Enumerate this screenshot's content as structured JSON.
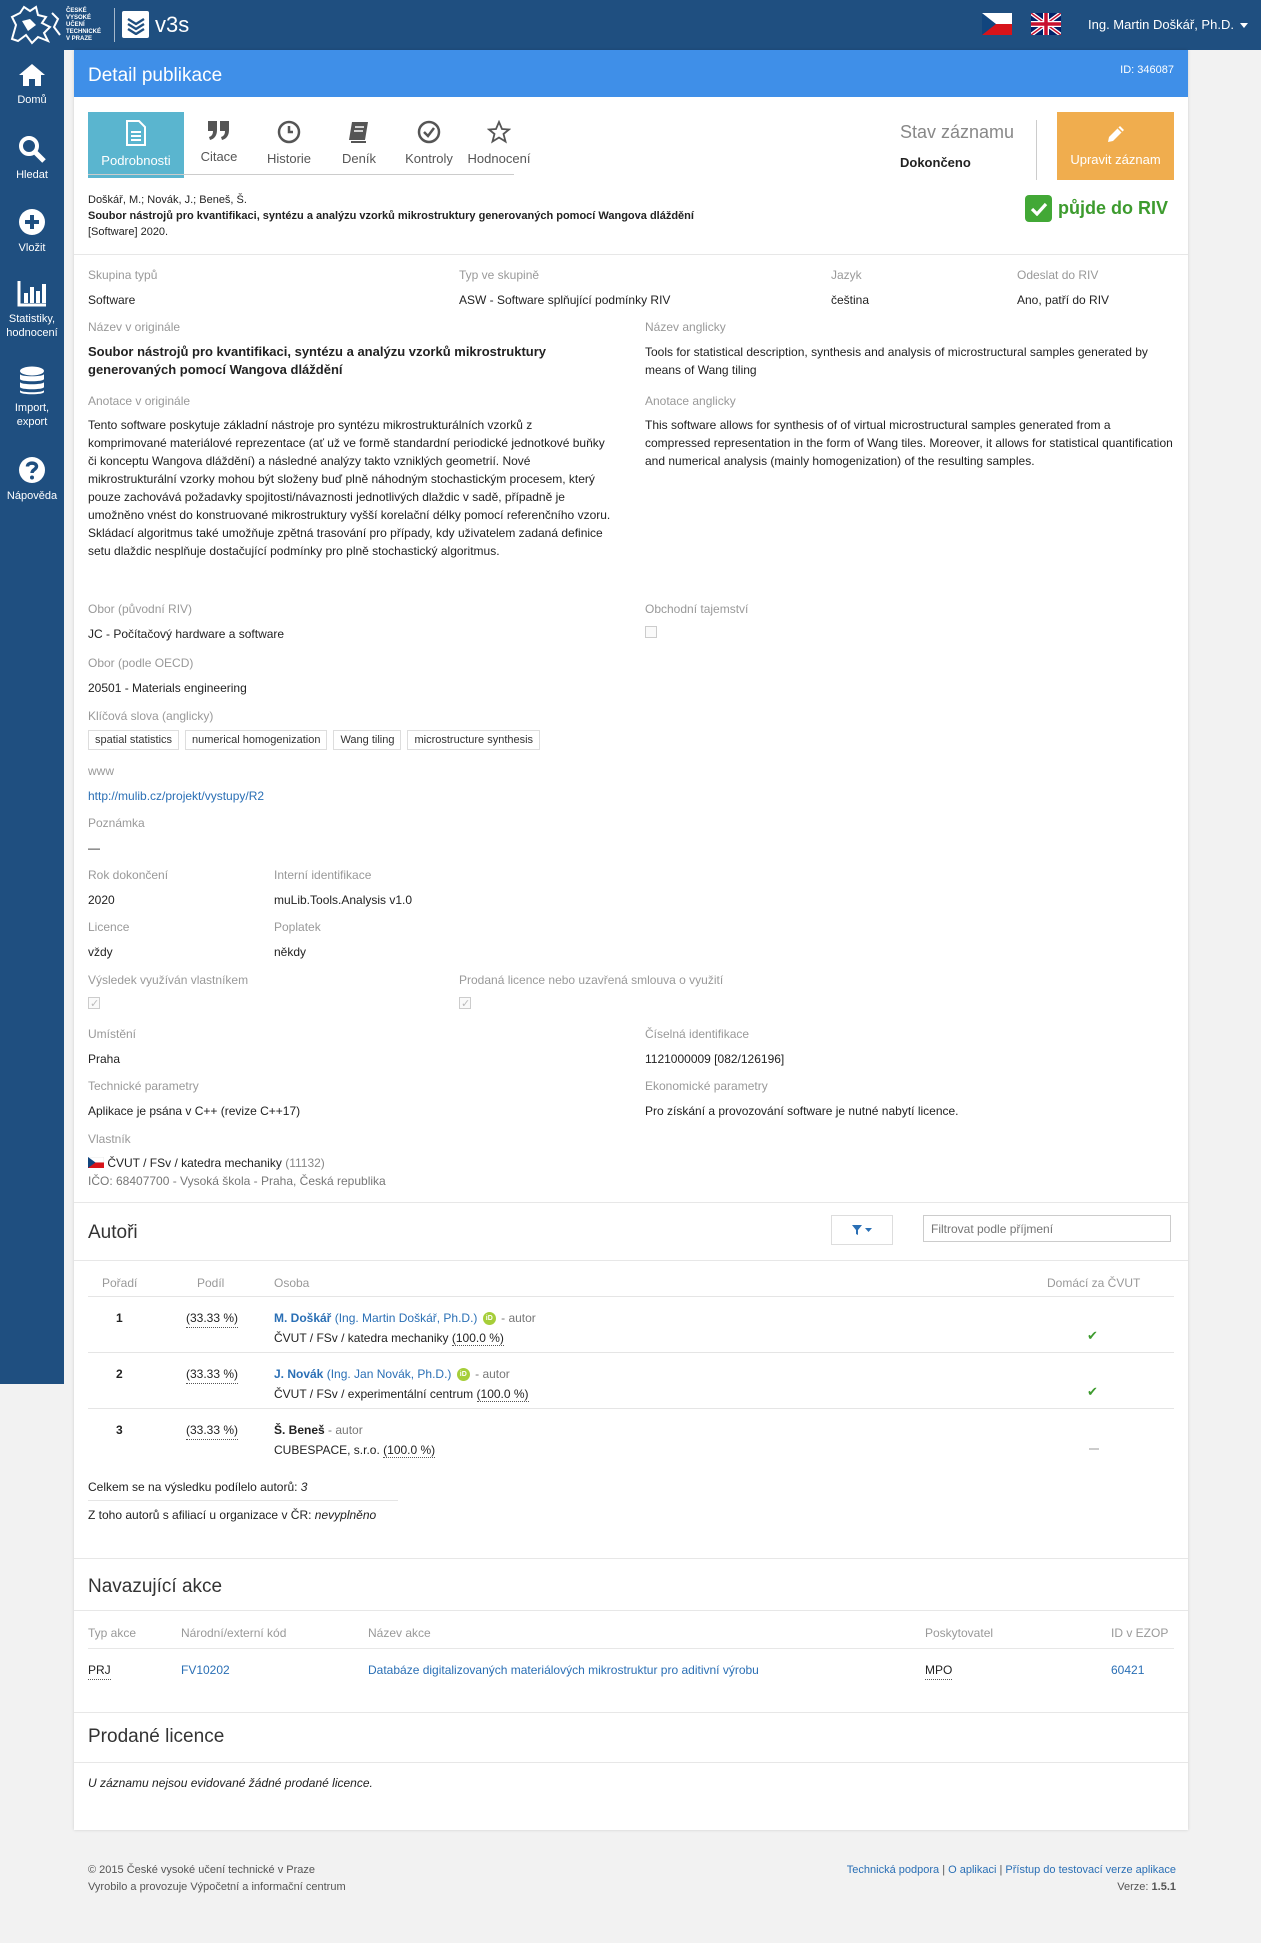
{
  "header": {
    "institution_lines": [
      "České",
      "vysoké",
      "učení",
      "technické",
      "v Praze"
    ],
    "app_name": "v3s",
    "user_name": "Ing. Martin Doškář, Ph.D."
  },
  "sidebar": {
    "items": [
      {
        "label": "Domů",
        "icon": "home-icon"
      },
      {
        "label": "Hledat",
        "icon": "search-icon"
      },
      {
        "label": "Vložit",
        "icon": "plus-circle-icon"
      },
      {
        "label_lines": [
          "Statistiky,",
          "hodnocení"
        ],
        "icon": "bar-chart-icon"
      },
      {
        "label_lines": [
          "Import,",
          "export"
        ],
        "icon": "database-icon"
      },
      {
        "label": "Nápověda",
        "icon": "question-circle-icon"
      }
    ]
  },
  "card": {
    "title": "Detail publikace",
    "record_id": "ID: 346087"
  },
  "tabs": [
    {
      "label": "Podrobnosti",
      "icon": "document-icon",
      "active": true
    },
    {
      "label": "Citace",
      "icon": "quote-icon"
    },
    {
      "label": "Historie",
      "icon": "clock-icon"
    },
    {
      "label": "Deník",
      "icon": "book-icon"
    },
    {
      "label": "Kontroly",
      "icon": "check-circle-icon"
    },
    {
      "label": "Hodnocení",
      "icon": "star-icon"
    }
  ],
  "state": {
    "label": "Stav záznamu",
    "value": "Dokončeno",
    "edit_button": "Upravit záznam"
  },
  "citation": {
    "authors": "Doškář, M.; Novák, J.; Beneš, Š.",
    "title": "Soubor nástrojů pro kvantifikaci, syntézu a analýzu vzorků mikrostruktury generovaných pomocí Wangova dláždění",
    "suffix": "[Software] 2020."
  },
  "riv_badge": "půjde do RIV",
  "fields": {
    "skupina_typu": {
      "label": "Skupina typů",
      "value": "Software"
    },
    "typ_ve_skupine": {
      "label": "Typ ve skupině",
      "value": "ASW - Software splňující podmínky RIV"
    },
    "jazyk": {
      "label": "Jazyk",
      "value": "čeština"
    },
    "odeslat_do_riv": {
      "label": "Odeslat do RIV",
      "value": "Ano, patří do RIV"
    },
    "nazev_originale": {
      "label": "Název v originále",
      "value": "Soubor nástrojů pro kvantifikaci, syntézu a analýzu vzorků mikrostruktury generovaných pomocí Wangova dláždění"
    },
    "nazev_anglicky": {
      "label": "Název anglicky",
      "value": "Tools for statistical description, synthesis and analysis of microstructural samples generated by means of Wang tiling"
    },
    "anotace_originale": {
      "label": "Anotace v originále",
      "value": "Tento software poskytuje základní nástroje pro syntézu mikrostrukturálních vzorků z komprimované materiálové reprezentace (ať už ve formě standardní periodické jednotkové buňky či konceptu Wangova dláždění) a následné analýzy takto vzniklých geometrií. Nové mikrostrukturální vzorky mohou být složeny buď plně náhodným stochastickým procesem, který pouze zachovává požadavky spojitosti/návaznosti jednotlivých dlaždic v sadě, případně je umožněno vnést do konstruované mikrostruktury vyšší korelační délky pomocí referenčního vzoru. Skládací algoritmus také umožňuje zpětná trasování pro případy, kdy uživatelem zadaná definice setu dlaždic nesplňuje dostačující podmínky pro plně stochastický algoritmus."
    },
    "anotace_anglicky": {
      "label": "Anotace anglicky",
      "value": "This software allows for synthesis of of virtual microstructural samples generated from a compressed representation in the form of Wang tiles. Moreover, it allows for statistical quantification and numerical analysis (mainly homogenization) of the resulting samples."
    },
    "obor_riv": {
      "label": "Obor (původní RIV)",
      "value": "JC - Počítačový hardware a software"
    },
    "obchodni_tajemstvi": {
      "label": "Obchodní tajemství",
      "checked": false
    },
    "obor_oecd": {
      "label": "Obor (podle OECD)",
      "value": "20501 - Materials engineering"
    },
    "klicova_slova": {
      "label": "Klíčová slova (anglicky)",
      "tags": [
        "spatial statistics",
        "numerical homogenization",
        "Wang tiling",
        "microstructure synthesis"
      ]
    },
    "www": {
      "label": "www",
      "value": "http://mulib.cz/projekt/vystupy/R2"
    },
    "poznamka": {
      "label": "Poznámka",
      "value": "—"
    },
    "rok_dokonceni": {
      "label": "Rok dokončení",
      "value": "2020"
    },
    "interni_identifikace": {
      "label": "Interní identifikace",
      "value": "muLib.Tools.Analysis v1.0"
    },
    "licence": {
      "label": "Licence",
      "value": "vždy"
    },
    "poplatek": {
      "label": "Poplatek",
      "value": "někdy"
    },
    "vysledek_vyuzivan": {
      "label": "Výsledek využíván vlastníkem",
      "checked": true
    },
    "prodana_licence": {
      "label": "Prodaná licence nebo uzavřená smlouva o využití",
      "checked": true
    },
    "umisteni": {
      "label": "Umístění",
      "value": "Praha"
    },
    "ciselna_identifikace": {
      "label": "Číselná identifikace",
      "value": "1121000009 [082/126196]"
    },
    "technicke_parametry": {
      "label": "Technické parametry",
      "value": "Aplikace je psána v C++ (revize C++17)"
    },
    "ekonomicke_parametry": {
      "label": "Ekonomické parametry",
      "value": "Pro získání a provozování software je nutné nabytí licence."
    },
    "vlastnik": {
      "label": "Vlastník",
      "org": "ČVUT / FSv / katedra mechaniky",
      "org_code": "(11132)",
      "ico_line": "IČO: 68407700 - Vysoká škola - Praha, Česká republika"
    }
  },
  "authors": {
    "title": "Autoři",
    "filter_placeholder": "Filtrovat podle příjmení",
    "columns": {
      "poradi": "Pořadí",
      "podil": "Podíl",
      "osoba": "Osoba",
      "domaci": "Domácí za ČVUT"
    },
    "rows": [
      {
        "order": "1",
        "share": "(33.33 %)",
        "short": "M. Doškář",
        "full": "(Ing. Martin Doškář, Ph.D.)",
        "role": "- autor",
        "affil": "ČVUT / FSv / katedra mechaniky",
        "affil_share": "(100.0 %)",
        "domestic": true
      },
      {
        "order": "2",
        "share": "(33.33 %)",
        "short": "J. Novák",
        "full": "(Ing. Jan Novák, Ph.D.)",
        "role": "- autor",
        "affil": "ČVUT / FSv / experimentální centrum",
        "affil_share": "(100.0 %)",
        "domestic": true
      },
      {
        "order": "3",
        "share": "(33.33 %)",
        "short": "Š. Beneš",
        "full": "",
        "role": "- autor",
        "affil": "CUBESPACE, s.r.o.",
        "affil_share": "(100.0 %)",
        "domestic": false
      }
    ],
    "total_label": "Celkem se na výsledku podílelo autorů:",
    "total_value": "3",
    "affil_label": "Z toho autorů s afiliací u organizace v ČR:",
    "affil_value": "nevyplněno"
  },
  "actions": {
    "title": "Navazující akce",
    "columns": {
      "typ": "Typ akce",
      "kod": "Národní/externí kód",
      "nazev": "Název akce",
      "poskytovatel": "Poskytovatel",
      "ezop": "ID v EZOP"
    },
    "rows": [
      {
        "typ": "PRJ",
        "kod": "FV10202",
        "nazev": "Databáze digitalizovaných materiálových mikrostruktur pro aditivní výrobu",
        "poskytovatel": "MPO",
        "ezop": "60421"
      }
    ]
  },
  "licences": {
    "title": "Prodané licence",
    "empty": "U záznamu nejsou evidované žádné prodané licence."
  },
  "footer": {
    "copyright": "© 2015 České vysoké učení technické v Praze",
    "operated": "Vyrobilo a provozuje Výpočetní a informační centrum",
    "links": [
      "Technická podpora",
      "O aplikaci",
      "Přístup do testovací verze aplikace"
    ],
    "version_label": "Verze:",
    "version": "1.5.1"
  },
  "colors": {
    "topbar": "#1f4f80",
    "card_header": "#3f8fe8",
    "active_tab": "#5ab5cf",
    "edit_button": "#f0ad4e",
    "riv_green": "#42a836"
  }
}
